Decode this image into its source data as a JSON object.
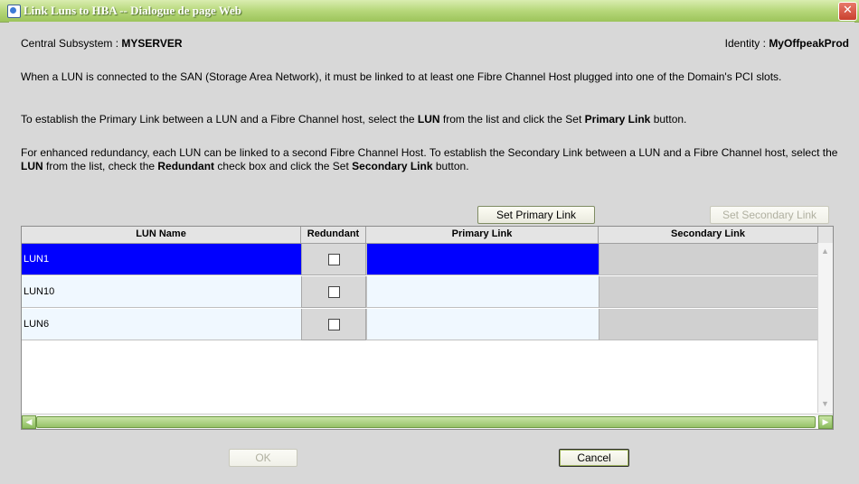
{
  "window": {
    "title": "Link Luns to HBA -- Dialogue de page Web",
    "close_glyph": "✕"
  },
  "header": {
    "subsystem_label": "Central Subsystem : ",
    "subsystem_value": "MYSERVER",
    "identity_label": "Identity : ",
    "identity_value": "MyOffpeakProd"
  },
  "instructions": {
    "p1": "When a LUN is connected to the SAN (Storage Area Network), it must be linked to at least one Fibre Channel Host plugged into one of the Domain's PCI slots.",
    "p2_a": "To establish the Primary Link between a LUN and a Fibre Channel host, select the ",
    "p2_b": "LUN",
    "p2_c": " from the list and click the Set ",
    "p2_d": "Primary Link",
    "p2_e": " button.",
    "p3_a": "For enhanced redundancy, each LUN can be linked to a second Fibre Channel Host. To establish the Secondary Link between a LUN and a Fibre Channel host, select the ",
    "p3_b": "LUN",
    "p3_c": " from the list, check the ",
    "p3_d": "Redundant",
    "p3_e": " check box and click the Set ",
    "p3_f": "Secondary Link",
    "p3_g": " button."
  },
  "buttons": {
    "set_primary": "Set Primary Link",
    "set_secondary": "Set Secondary Link",
    "ok": "OK",
    "cancel": "Cancel"
  },
  "table": {
    "columns": [
      "LUN Name",
      "Redundant",
      "Primary Link",
      "Secondary Link"
    ],
    "rows": [
      {
        "name": "LUN1",
        "redundant": false,
        "primary": "",
        "secondary": ""
      },
      {
        "name": "LUN10",
        "redundant": false,
        "primary": "",
        "secondary": ""
      },
      {
        "name": "LUN6",
        "redundant": false,
        "primary": "",
        "secondary": ""
      }
    ],
    "selected_row": 0
  },
  "colors": {
    "title_bar": "#9cc45a",
    "selection": "#0000ff"
  }
}
